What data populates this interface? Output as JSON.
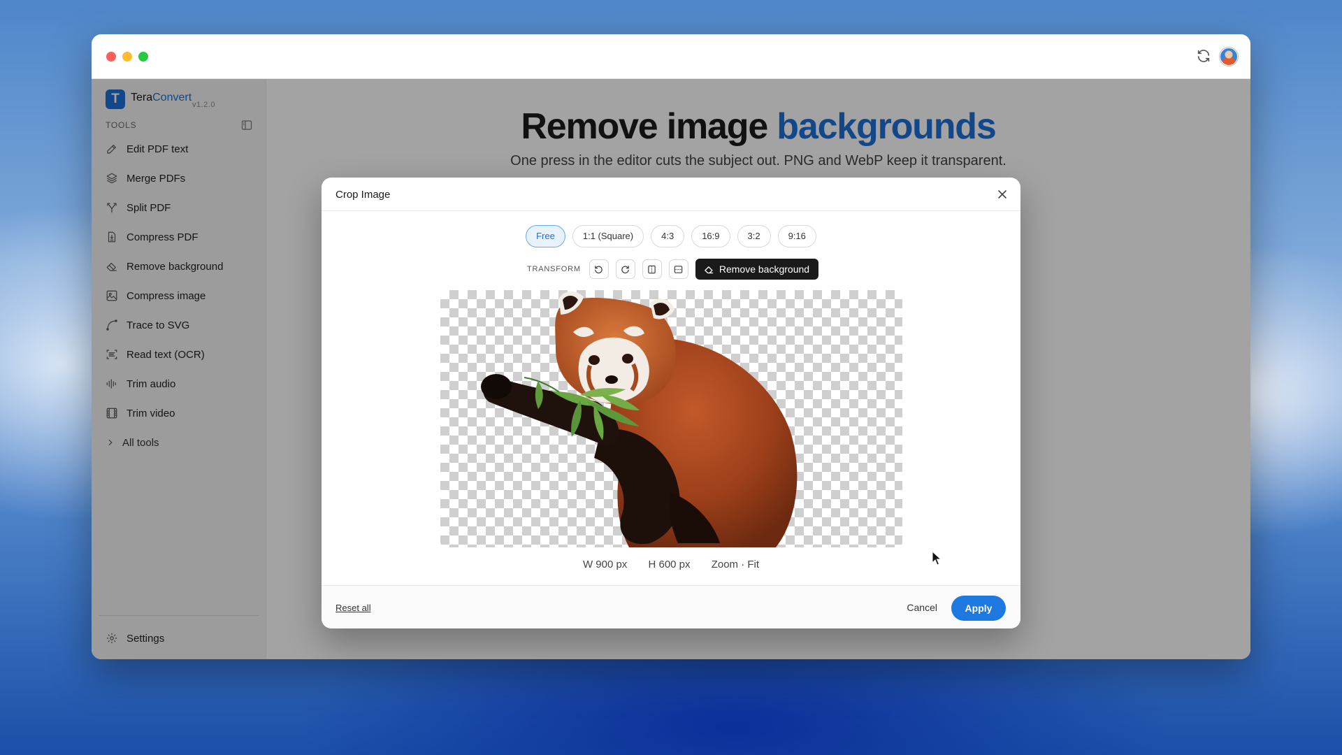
{
  "app": {
    "brand_main": "Tera",
    "brand_accent": "Convert",
    "version": "v1.2.0",
    "logo_letter": "T"
  },
  "sidebar": {
    "section_title": "TOOLS",
    "items": [
      {
        "label": "Edit PDF text",
        "icon": "pencil-icon"
      },
      {
        "label": "Merge PDFs",
        "icon": "layers-icon"
      },
      {
        "label": "Split PDF",
        "icon": "split-icon"
      },
      {
        "label": "Compress PDF",
        "icon": "file-compress-icon"
      },
      {
        "label": "Remove background",
        "icon": "eraser-icon"
      },
      {
        "label": "Compress image",
        "icon": "image-compress-icon"
      },
      {
        "label": "Trace to SVG",
        "icon": "curve-icon"
      },
      {
        "label": "Read text (OCR)",
        "icon": "scan-text-icon"
      },
      {
        "label": "Trim audio",
        "icon": "audio-wave-icon"
      },
      {
        "label": "Trim video",
        "icon": "film-icon"
      }
    ],
    "all_tools": "All tools",
    "settings": "Settings"
  },
  "main": {
    "title_main": "Remove image ",
    "title_accent": "backgrounds",
    "subtitle": "One press in the editor cuts the subject out. PNG and WebP keep it transparent."
  },
  "modal": {
    "title": "Crop Image",
    "ratios": [
      "Free",
      "1:1 (Square)",
      "4:3",
      "16:9",
      "3:2",
      "9:16"
    ],
    "active_ratio": "Free",
    "transform_label": "TRANSFORM",
    "remove_bg_label": "Remove background",
    "width_label": "W 900 px",
    "height_label": "H 600 px",
    "zoom_label": "Zoom · Fit",
    "reset_label": "Reset all",
    "cancel_label": "Cancel",
    "apply_label": "Apply"
  },
  "colors": {
    "accent": "#1d6fd6",
    "apply": "#1d78e0",
    "dark_button": "#1a1a1a"
  }
}
